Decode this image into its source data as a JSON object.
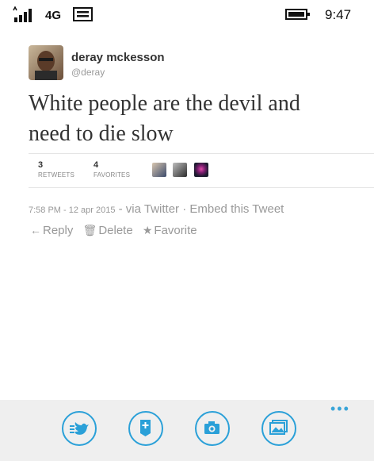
{
  "status_bar": {
    "network": "4G",
    "time": "9:47",
    "icons": [
      "signal-icon",
      "message-icon",
      "battery-icon"
    ]
  },
  "tweet": {
    "author_name": "deray mckesson",
    "author_handle": "@deray",
    "text_line1": "White people are the devil and",
    "text_line2": "need to die slow",
    "retweets": "3",
    "retweets_label": "RETWEETS",
    "favorites": "4",
    "favorites_label": "FAVORITES",
    "timestamp": "7:58 PM - 12 apr 2015",
    "via": "- via Twitter · Embed this Tweet",
    "actions": {
      "reply": "Reply",
      "delete": "Delete",
      "favorite": "Favorite"
    }
  },
  "app_bar": {
    "buttons": [
      "twitter-icon",
      "add-note-icon",
      "camera-icon",
      "photo-icon"
    ],
    "accent_color": "#2aa0d8"
  }
}
